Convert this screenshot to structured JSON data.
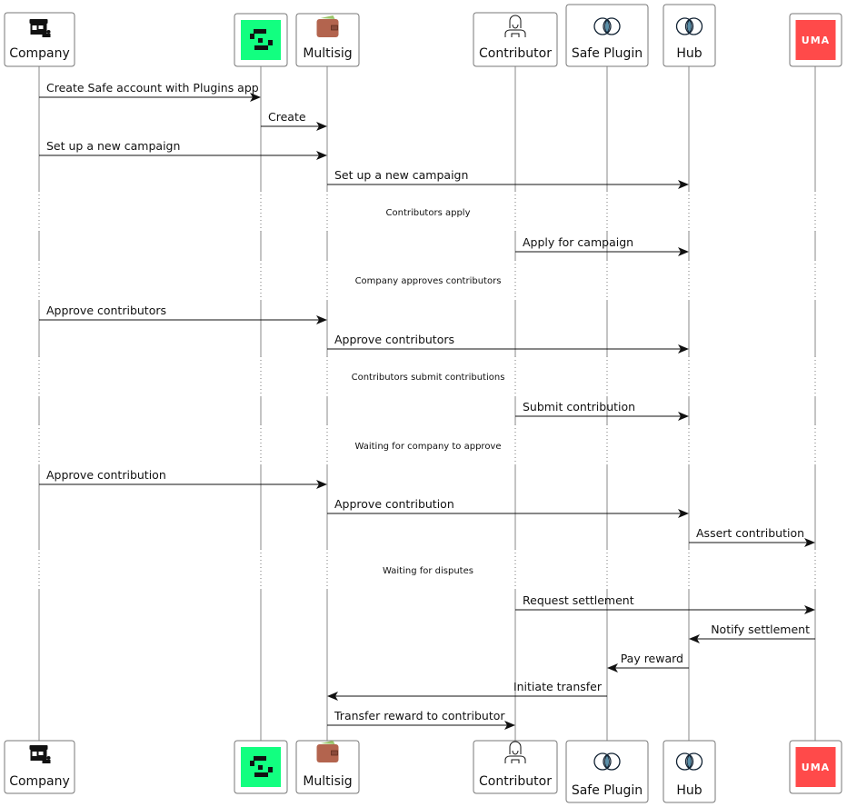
{
  "participants": [
    {
      "id": "company",
      "label": "Company",
      "icon": "store-icon"
    },
    {
      "id": "safe",
      "label": "",
      "icon": "safe-logo-icon",
      "color": "#12ff80"
    },
    {
      "id": "multisig",
      "label": "Multisig",
      "icon": "wallet-icon"
    },
    {
      "id": "contributor",
      "label": "Contributor",
      "icon": "person-icon"
    },
    {
      "id": "plugin",
      "label": "Safe Plugin",
      "icon": "linked-circles-icon"
    },
    {
      "id": "hub",
      "label": "Hub",
      "icon": "linked-circles-icon"
    },
    {
      "id": "uma",
      "label": "",
      "icon": "uma-logo-icon",
      "logo_text": "UMA",
      "color": "#ff4a4a"
    }
  ],
  "events": [
    {
      "type": "msg",
      "from": "company",
      "to": "safe",
      "label": "Create Safe account with Plugins app"
    },
    {
      "type": "msg",
      "from": "safe",
      "to": "multisig",
      "label": "Create"
    },
    {
      "type": "msg",
      "from": "company",
      "to": "multisig",
      "label": "Set up a new campaign"
    },
    {
      "type": "msg",
      "from": "multisig",
      "to": "hub",
      "label": "Set up a new campaign"
    },
    {
      "type": "divider",
      "label": "Contributors apply"
    },
    {
      "type": "msg",
      "from": "contributor",
      "to": "hub",
      "label": "Apply for campaign"
    },
    {
      "type": "divider",
      "label": "Company approves contributors"
    },
    {
      "type": "msg",
      "from": "company",
      "to": "multisig",
      "label": "Approve contributors"
    },
    {
      "type": "msg",
      "from": "multisig",
      "to": "hub",
      "label": "Approve contributors"
    },
    {
      "type": "divider",
      "label": "Contributors submit contributions"
    },
    {
      "type": "msg",
      "from": "contributor",
      "to": "hub",
      "label": "Submit contribution"
    },
    {
      "type": "divider",
      "label": "Waiting for company to approve"
    },
    {
      "type": "msg",
      "from": "company",
      "to": "multisig",
      "label": "Approve contribution"
    },
    {
      "type": "msg",
      "from": "multisig",
      "to": "hub",
      "label": "Approve contribution"
    },
    {
      "type": "msg",
      "from": "hub",
      "to": "uma",
      "label": "Assert contribution"
    },
    {
      "type": "divider",
      "label": "Waiting for disputes"
    },
    {
      "type": "msg",
      "from": "contributor",
      "to": "uma",
      "label": "Request settlement"
    },
    {
      "type": "msg",
      "from": "uma",
      "to": "hub",
      "label": "Notify settlement"
    },
    {
      "type": "msg",
      "from": "hub",
      "to": "plugin",
      "label": "Pay reward"
    },
    {
      "type": "msg",
      "from": "plugin",
      "to": "multisig",
      "label": "Initiate transfer"
    },
    {
      "type": "msg",
      "from": "multisig",
      "to": "contributor",
      "label": "Transfer reward to contributor"
    }
  ]
}
